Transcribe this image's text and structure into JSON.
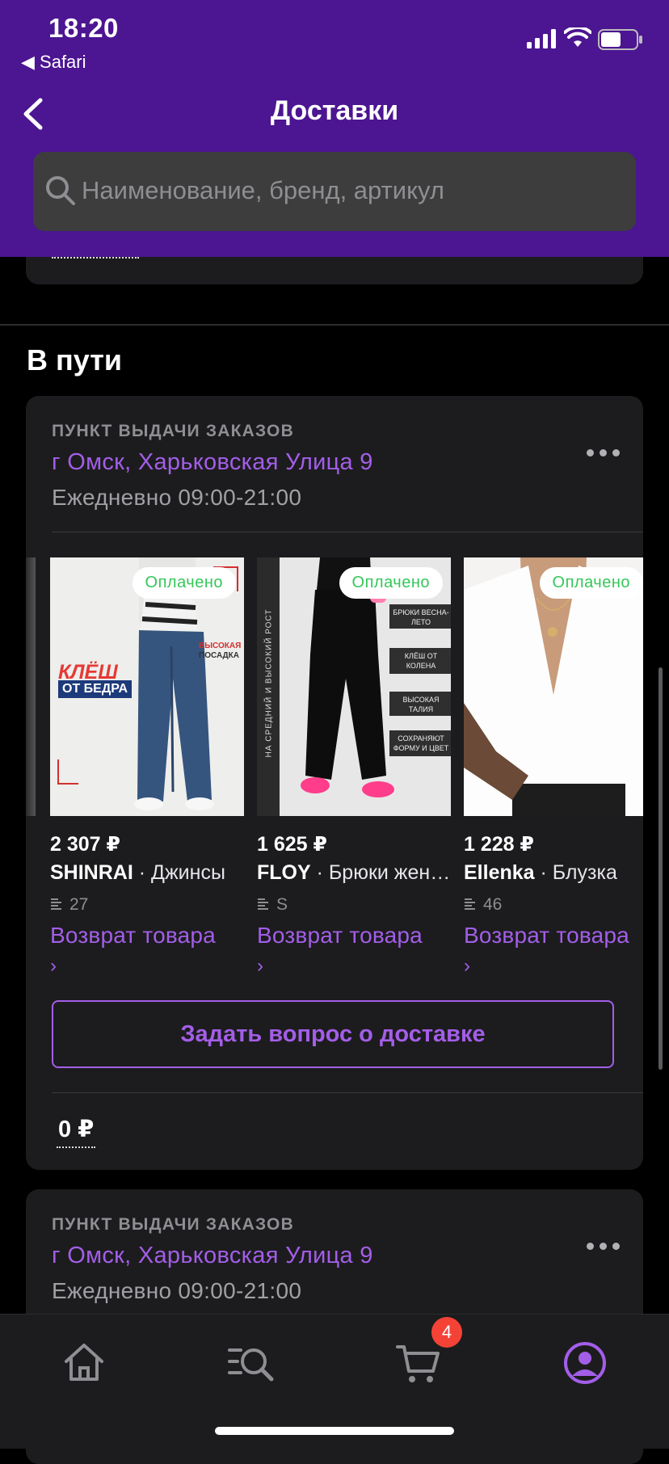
{
  "status_bar": {
    "time": "18:20",
    "back_app": "◀ Safari"
  },
  "header": {
    "title": "Доставки"
  },
  "search": {
    "placeholder": "Наименование, бренд, артикул"
  },
  "section": {
    "title": "В пути"
  },
  "cards": [
    {
      "pickup_label": "ПУНКТ ВЫДАЧИ ЗАКАЗОВ",
      "address": "г Омск, Харьковская Улица 9",
      "hours": "Ежедневно 09:00-21:00",
      "products": [
        {
          "status": "Оплачено",
          "price": "2 307 ₽",
          "brand": "SHINRAI",
          "name": " · Джинсы",
          "size": "27",
          "return_label": "Возврат товара",
          "return_arrow": "›",
          "thumb_text_1": "КЛЁШ",
          "thumb_text_2": "ОТ БЕДРА",
          "thumb_text_3": "ВЫСОКАЯ",
          "thumb_text_4": "ПОСАДКА"
        },
        {
          "status": "Оплачено",
          "price": "1 625 ₽",
          "brand": "FLOY",
          "name": " · Брюки женские",
          "size": "S",
          "return_label": "Возврат товара",
          "return_arrow": "›",
          "thumb_text_1": "БРЮКИ ВЕСНА-ЛЕТО",
          "thumb_text_2": "КЛЁШ ОТ КОЛЕНА",
          "thumb_text_3": "ВЫСОКАЯ ТАЛИЯ",
          "thumb_text_4": "СОХРАНЯЮТ ФОРМУ И ЦВЕТ",
          "thumb_side": "НА СРЕДНИЙ И ВЫСОКИЙ РОСТ"
        },
        {
          "status": "Оплачено",
          "price": "1 228 ₽",
          "brand": "Ellenka",
          "name": " · Блузка",
          "size": "46",
          "return_label": "Возврат товара",
          "return_arrow": "›"
        }
      ],
      "ask_button": "Задать вопрос о доставке",
      "sum": "0 ₽"
    },
    {
      "pickup_label": "ПУНКТ ВЫДАЧИ ЗАКАЗОВ",
      "address": "г Омск, Харьковская Улица 9",
      "hours": "Ежедневно 09:00-21:00"
    }
  ],
  "tabbar": {
    "items": [
      {
        "icon": "home-icon"
      },
      {
        "icon": "catalog-search-icon"
      },
      {
        "icon": "cart-icon",
        "badge": "4"
      },
      {
        "icon": "profile-icon"
      }
    ]
  },
  "colors": {
    "header_bg": "#4c1591",
    "accent": "#a35ee8",
    "paid": "#34c759",
    "badge": "#f44336"
  }
}
